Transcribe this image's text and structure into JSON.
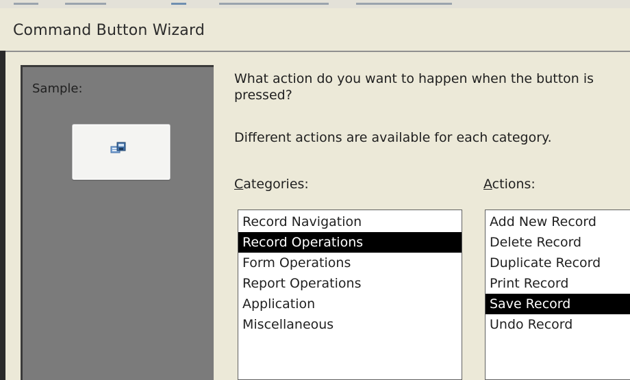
{
  "window": {
    "title": "Command Button Wizard"
  },
  "sample": {
    "label": "Sample:",
    "button_icon": "form-icon"
  },
  "instructions": {
    "question": "What action do you want to happen when the button is pressed?",
    "hint": "Different actions are available for each category."
  },
  "categories": {
    "label_accel": "C",
    "label_rest": "ategories:",
    "items": [
      "Record Navigation",
      "Record Operations",
      "Form Operations",
      "Report Operations",
      "Application",
      "Miscellaneous"
    ],
    "selected": "Record Operations"
  },
  "actions": {
    "label_accel": "A",
    "label_rest": "ctions:",
    "items": [
      "Add New Record",
      "Delete Record",
      "Duplicate Record",
      "Print Record",
      "Save Record",
      "Undo Record"
    ],
    "selected": "Save Record"
  },
  "colors": {
    "dialog_background": "#ece9d8",
    "sample_panel": "#7b7b7b",
    "selection": "#000000"
  }
}
